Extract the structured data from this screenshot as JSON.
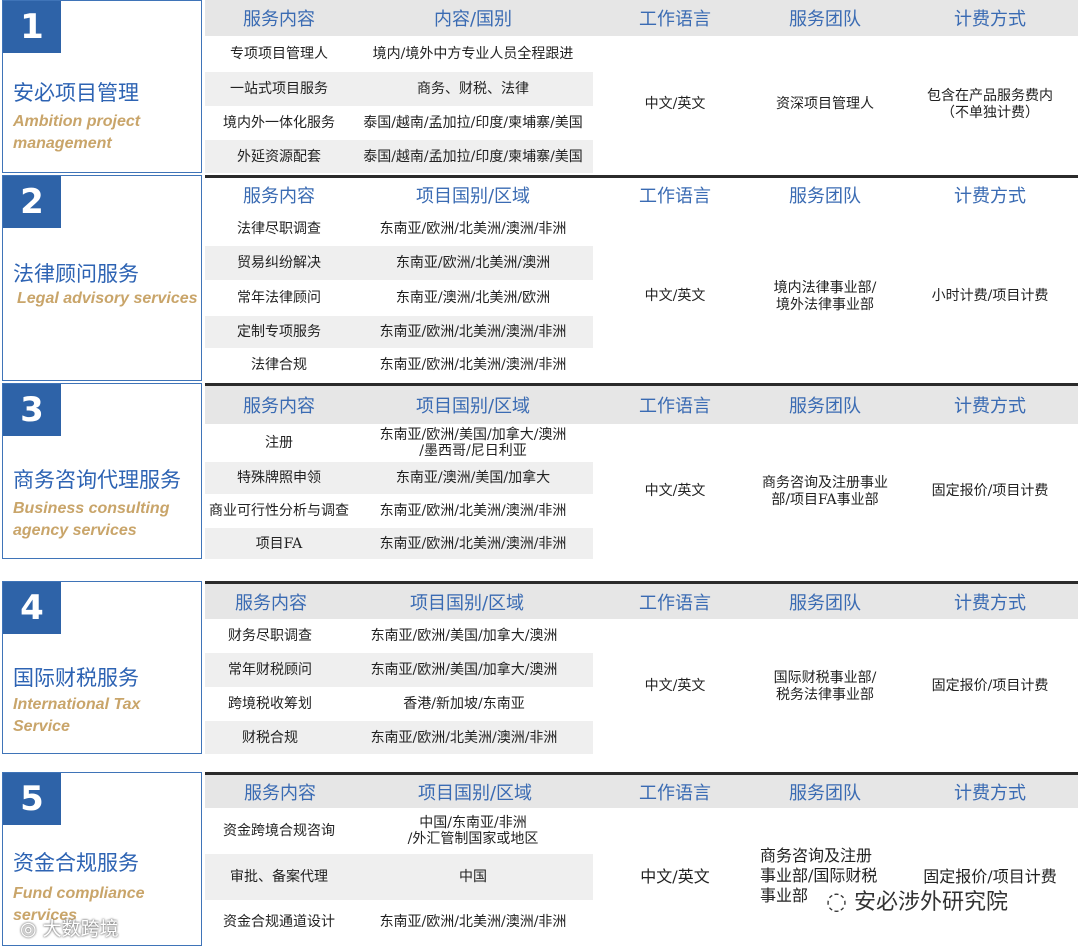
{
  "sections": [
    {
      "num": "1",
      "title_cn": "安必项目管理",
      "title_en": "Ambition project management",
      "headers": [
        "服务内容",
        "内容/国别",
        "工作语言",
        "服务团队",
        "计费方式"
      ],
      "rows": [
        {
          "service": "专项项目管理人",
          "region": "境内/境外中方专业人员全程跟进"
        },
        {
          "service": "一站式项目服务",
          "region": "商务、财税、法律"
        },
        {
          "service": "境内外一体化服务",
          "region": "泰国/越南/孟加拉/印度/柬埔寨/美国"
        },
        {
          "service": "外延资源配套",
          "region": "泰国/越南/孟加拉/印度/柬埔寨/美国"
        }
      ],
      "language": "中文/英文",
      "team": "资深项目管理人",
      "billing": "包含在产品服务费内\n（不单独计费）"
    },
    {
      "num": "2",
      "title_cn": "法律顾问服务",
      "title_en": "Legal advisory services",
      "headers": [
        "服务内容",
        "项目国别/区域",
        "工作语言",
        "服务团队",
        "计费方式"
      ],
      "rows": [
        {
          "service": "法律尽职调查",
          "region": "东南亚/欧洲/北美洲/澳洲/非洲"
        },
        {
          "service": "贸易纠纷解决",
          "region": "东南亚/欧洲/北美洲/澳洲"
        },
        {
          "service": "常年法律顾问",
          "region": "东南亚/澳洲/北美洲/欧洲"
        },
        {
          "service": "定制专项服务",
          "region": "东南亚/欧洲/北美洲/澳洲/非洲"
        },
        {
          "service": "法律合规",
          "region": "东南亚/欧洲/北美洲/澳洲/非洲"
        }
      ],
      "language": "中文/英文",
      "team": "境内法律事业部/\n境外法律事业部",
      "billing": "小时计费/项目计费"
    },
    {
      "num": "3",
      "title_cn": "商务咨询代理服务",
      "title_en": "Business consulting agency services",
      "headers": [
        "服务内容",
        "项目国别/区域",
        "工作语言",
        "服务团队",
        "计费方式"
      ],
      "rows": [
        {
          "service": "注册",
          "region": "东南亚/欧洲/美国/加拿大/澳洲\n/墨西哥/尼日利亚"
        },
        {
          "service": "特殊牌照申领",
          "region": "东南亚/澳洲/美国/加拿大"
        },
        {
          "service": "商业可行性分析与调查",
          "region": "东南亚/欧洲/北美洲/澳洲/非洲"
        },
        {
          "service": "项目FA",
          "region": "东南亚/欧洲/北美洲/澳洲/非洲"
        }
      ],
      "language": "中文/英文",
      "team": "商务咨询及注册事业\n部/项目FA事业部",
      "billing": "固定报价/项目计费"
    },
    {
      "num": "4",
      "title_cn": "国际财税服务",
      "title_en": "International Tax Service",
      "headers": [
        "服务内容",
        "项目国别/区域",
        "工作语言",
        "服务团队",
        "计费方式"
      ],
      "rows": [
        {
          "service": "财务尽职调查",
          "region": "东南亚/欧洲/美国/加拿大/澳洲"
        },
        {
          "service": "常年财税顾问",
          "region": "东南亚/欧洲/美国/加拿大/澳洲"
        },
        {
          "service": "跨境税收筹划",
          "region": "香港/新加坡/东南亚"
        },
        {
          "service": "财税合规",
          "region": "东南亚/欧洲/北美洲/澳洲/非洲"
        }
      ],
      "language": "中文/英文",
      "team": "国际财税事业部/\n税务法律事业部",
      "billing": "固定报价/项目计费"
    },
    {
      "num": "5",
      "title_cn": "资金合规服务",
      "title_en": "Fund compliance services",
      "headers": [
        "服务内容",
        "项目国别/区域",
        "工作语言",
        "服务团队",
        "计费方式"
      ],
      "rows": [
        {
          "service": "资金跨境合规咨询",
          "region": "中国/东南亚/非洲\n/外汇管制国家或地区"
        },
        {
          "service": "审批、备案代理",
          "region": "中国"
        },
        {
          "service": "资金合规通道设计",
          "region": "东南亚/欧洲/北美洲/澳洲/非洲"
        }
      ],
      "language": "中文/英文",
      "team": "商务咨询及注册\n事业部/国际财税\n事业部",
      "billing": "固定报价/项目计费"
    }
  ],
  "watermarks": {
    "left": "大数跨境",
    "right": "安必涉外研究院"
  }
}
